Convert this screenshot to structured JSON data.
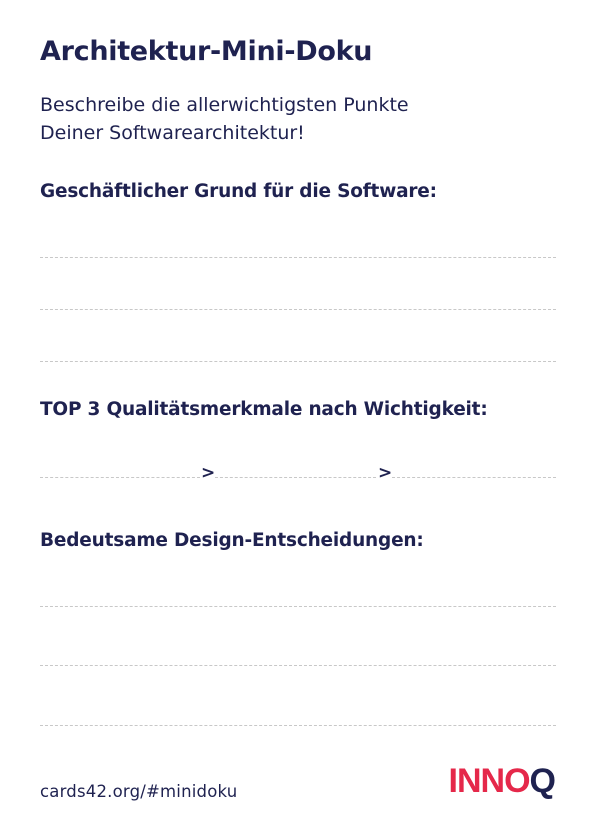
{
  "title": "Architektur-Mini-Doku",
  "subtitle": {
    "line1": "Beschreibe die allerwichtigsten Punkte",
    "line2": "Deiner Softwarearchitektur!"
  },
  "sections": [
    {
      "heading": "Geschäftlicher Grund für die Software:"
    },
    {
      "heading": "TOP 3 Qualitätsmerkmale nach Wichtigkeit:",
      "separator": ">"
    },
    {
      "heading": "Bedeutsame Design-Entscheidungen:"
    }
  ],
  "footer": {
    "link": "cards42.org/#minidoku",
    "logo": {
      "part1": "INNO",
      "part2": "Q",
      "color_primary": "#e5284a",
      "color_secondary": "#1f2250"
    }
  },
  "colors": {
    "text": "#1f2250",
    "accent": "#e5284a",
    "dashed_line": "#c8c8c8"
  }
}
